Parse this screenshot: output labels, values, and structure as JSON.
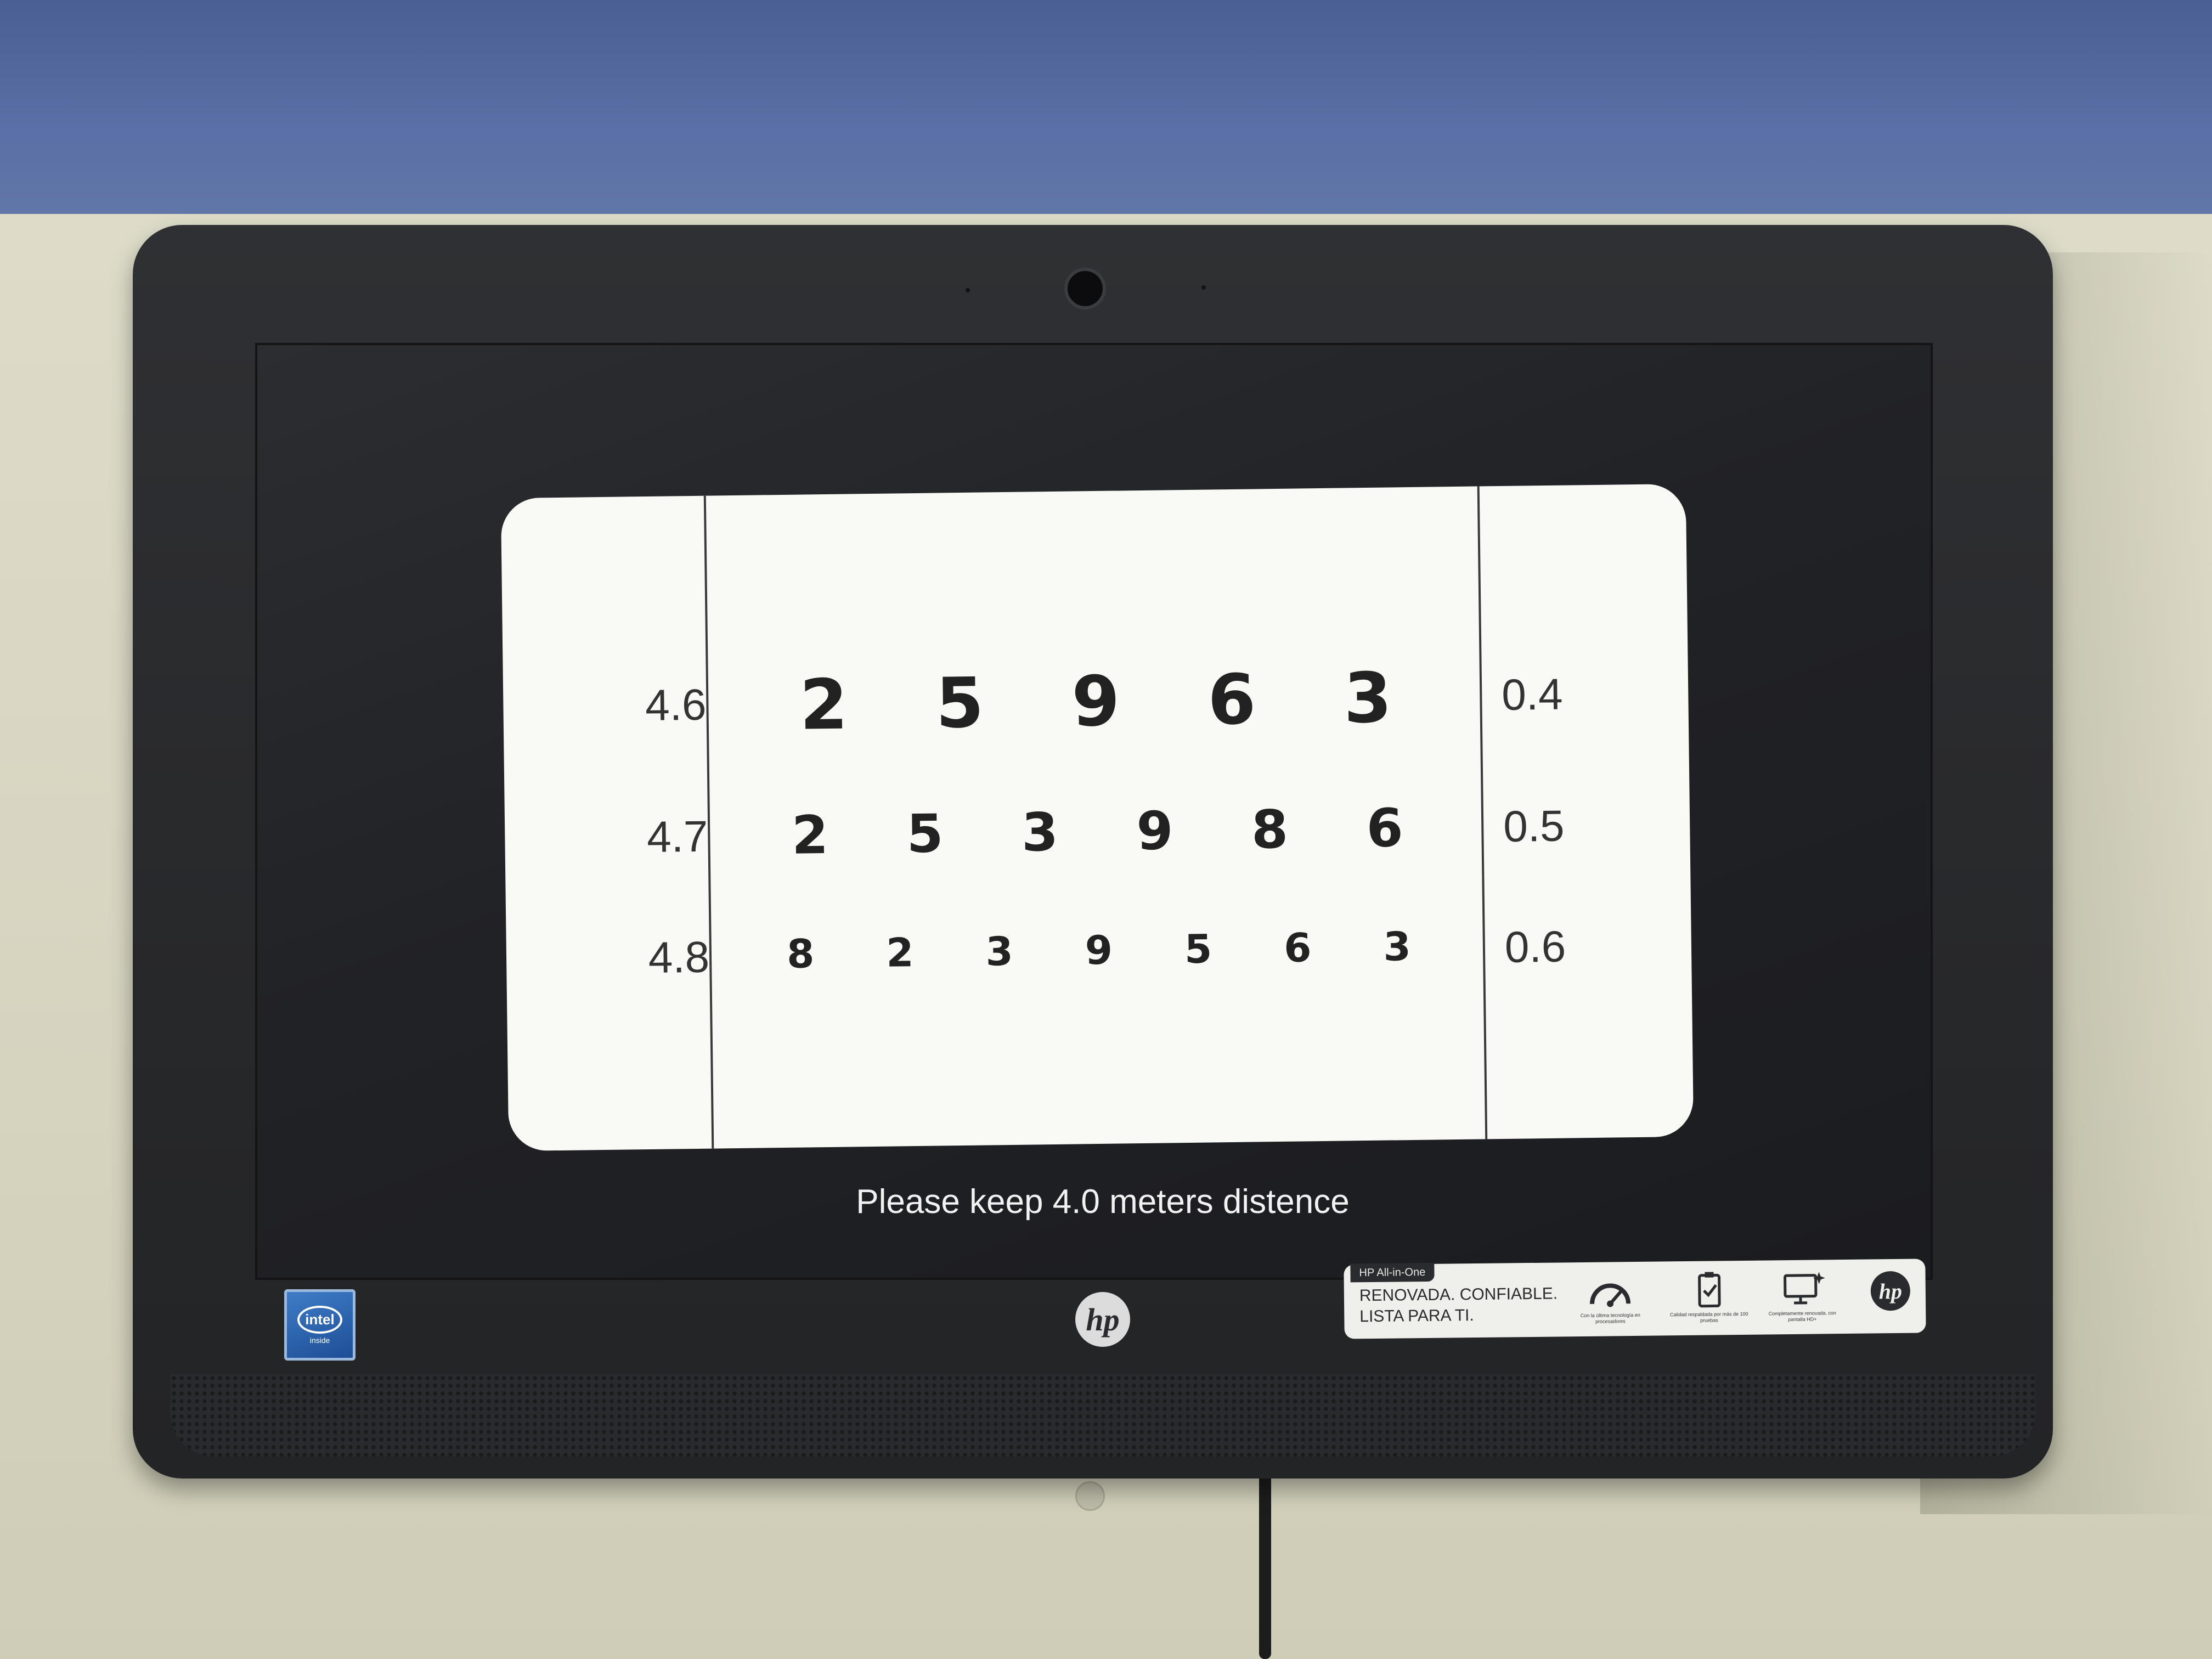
{
  "chart": {
    "rows": [
      {
        "left_value": "4.6",
        "digits": [
          "2",
          "5",
          "9",
          "6",
          "3"
        ],
        "right_value": "0.4"
      },
      {
        "left_value": "4.7",
        "digits": [
          "2",
          "5",
          "3",
          "9",
          "8",
          "6"
        ],
        "right_value": "0.5"
      },
      {
        "left_value": "4.8",
        "digits": [
          "8",
          "2",
          "3",
          "9",
          "5",
          "6",
          "3"
        ],
        "right_value": "0.6"
      }
    ]
  },
  "instruction": "Please keep 4.0 meters distence",
  "badges": {
    "intel_logo": "intel",
    "intel_inside": "inside",
    "hp_logo": "hp"
  },
  "sticker": {
    "tab": "HP All-in-One",
    "line1": "RENOVADA. CONFIABLE.",
    "line2": "LISTA PARA TI.",
    "icons": [
      {
        "icon": "speedometer-icon",
        "caption": "Con la última tecnología en procesadores"
      },
      {
        "icon": "clipboard-check-icon",
        "caption": "Calidad respaldada por más de 100 pruebas"
      },
      {
        "icon": "monitor-sparkle-icon",
        "caption": "Completamente renovada, con pantalla HD+"
      }
    ],
    "hp_logo": "hp"
  },
  "colors": {
    "wall_top": "#5a70a6",
    "wall_bottom": "#d9d8c6",
    "bezel": "#2a2b2e",
    "chart_bg": "#f9f9f5",
    "digit": "#222222"
  }
}
